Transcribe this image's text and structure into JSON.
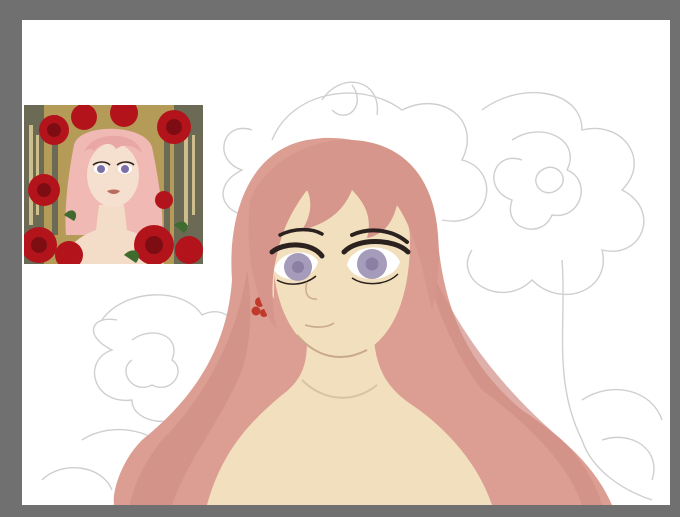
{
  "colors": {
    "frame": "#707070",
    "canvas": "#ffffff",
    "hair": "#dc9e93",
    "hair_shadow": "#c9827a",
    "skin": "#f1dfbd",
    "sketch": "#c9c9c9",
    "iris": "#a59bba",
    "eyeliner": "#2b211e",
    "earring": "#c0392b",
    "roses": "#b3141c",
    "reference_bg": "#b59b58"
  },
  "icons": {
    "reference_image": "reference-photo-icon",
    "sketch_layer": "pencil-sketch-icon"
  }
}
